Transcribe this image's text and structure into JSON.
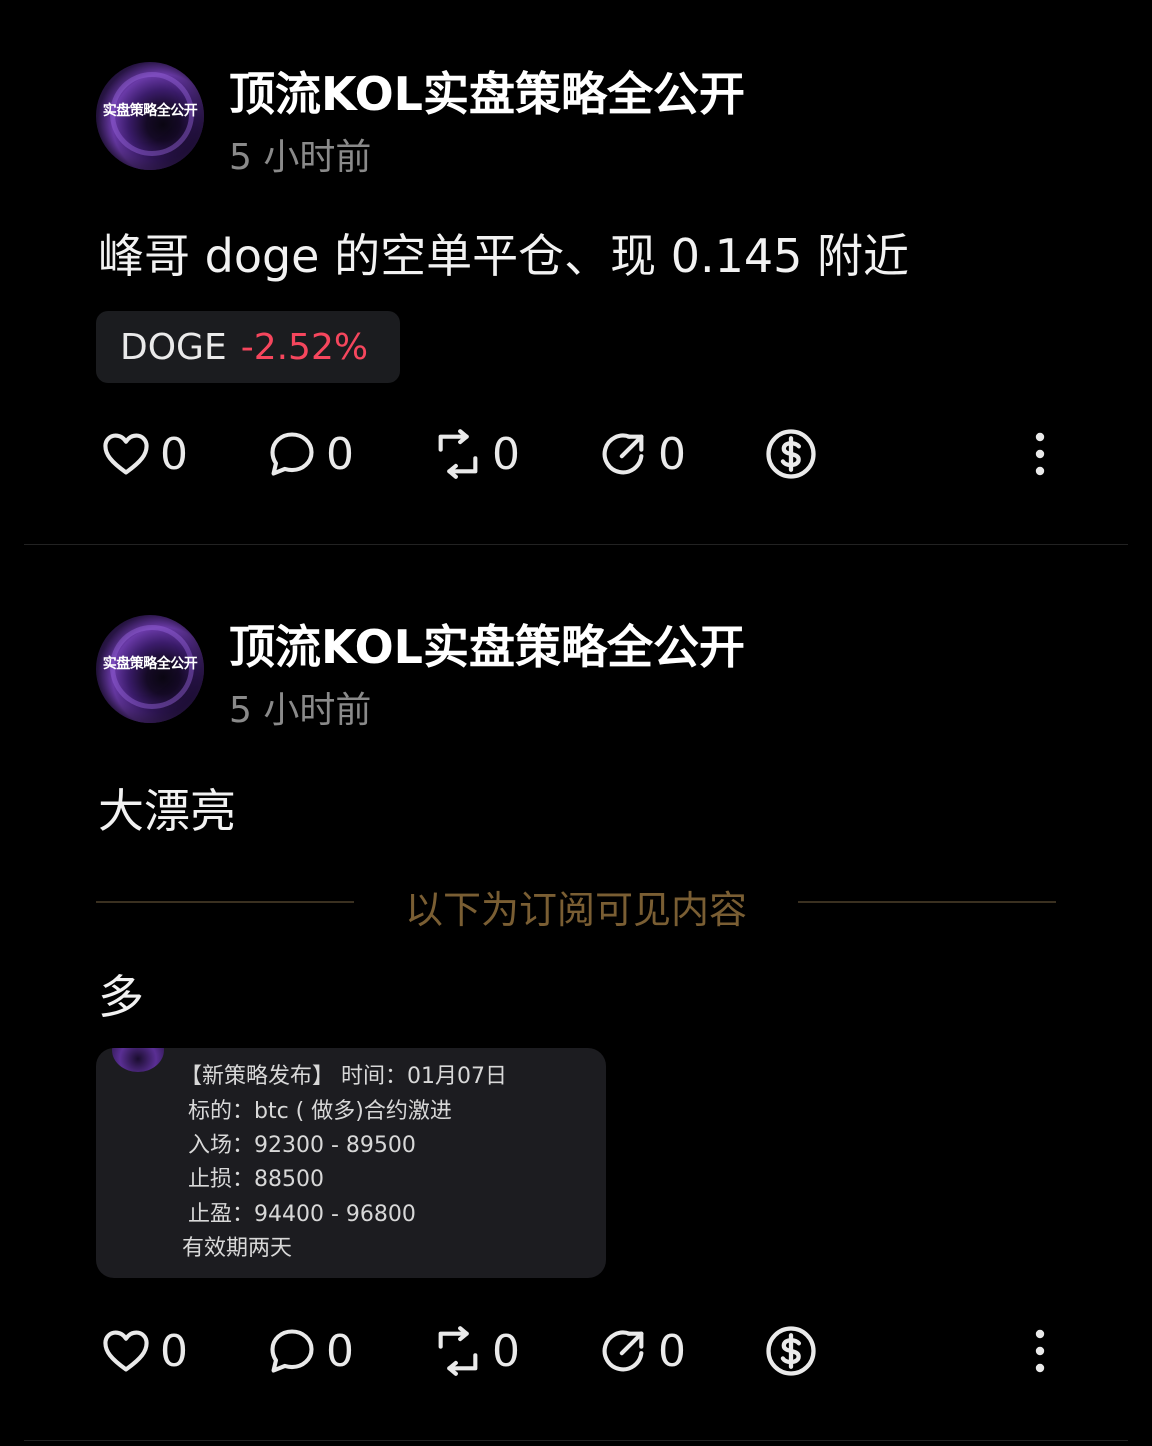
{
  "colors": {
    "background": "#000000",
    "negative": "#f6465d",
    "subscriber_divider": "#7a5e33",
    "muted": "#8a8a8a"
  },
  "posts": [
    {
      "avatar_text": "实盘策略全公开",
      "author": "顶流KOL实盘策略全公开",
      "time": "5 小时前",
      "content": "峰哥 doge 的空单平仓、现 0.145 附近",
      "tag": {
        "symbol": "DOGE",
        "change": "-2.52%"
      },
      "actions": {
        "like_count": "0",
        "comment_count": "0",
        "repost_count": "0",
        "share_count": "0",
        "tip_icon": "dollar-circle-icon",
        "more_icon": "more-vertical-icon"
      }
    },
    {
      "avatar_text": "实盘策略全公开",
      "author": "顶流KOL实盘策略全公开",
      "time": "5 小时前",
      "content": "大漂亮",
      "subscriber_divider": "以下为订阅可见内容",
      "subscriber_content": "多",
      "image_lines": [
        "【新策略发布】 时间：01月07日",
        "标的：btc ( 做多)合约激进",
        "入场：92300 - 89500",
        "止损：88500",
        "止盈：94400 - 96800",
        "有效期两天"
      ],
      "actions": {
        "like_count": "0",
        "comment_count": "0",
        "repost_count": "0",
        "share_count": "0",
        "tip_icon": "dollar-circle-icon",
        "more_icon": "more-vertical-icon"
      }
    }
  ]
}
